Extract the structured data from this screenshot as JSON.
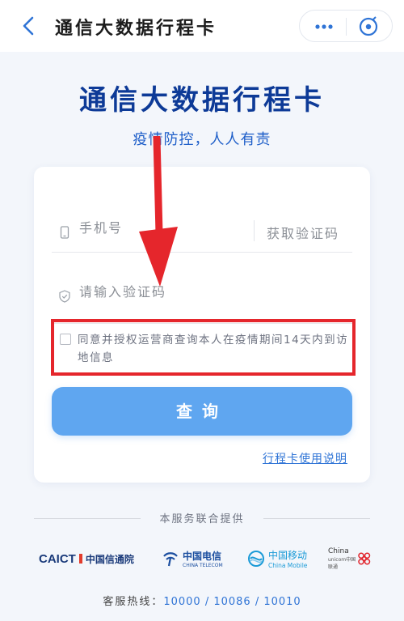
{
  "navbar": {
    "title": "通信大数据行程卡",
    "more_icon": "more-dots-icon",
    "close_icon": "close-target-icon",
    "back_icon": "chevron-left-icon"
  },
  "header": {
    "title": "通信大数据行程卡",
    "subtitle": "疫情防控，人人有责"
  },
  "form": {
    "phone_placeholder": "手机号",
    "get_code_label": "获取验证码",
    "code_placeholder": "请输入验证码",
    "consent_text": "同意并授权运营商查询本人在疫情期间14天内到访地信息",
    "consent_checked": false,
    "submit_label": "查询",
    "help_link": "行程卡使用说明"
  },
  "providers": {
    "label": "本服务联合提供",
    "caict": {
      "abbr": "CAICT",
      "name": "中国信通院"
    },
    "telecom": {
      "name": "中国电信",
      "en": "CHINA TELECOM"
    },
    "mobile": {
      "name": "中国移动",
      "en": "China Mobile"
    },
    "unicom": {
      "name": "China",
      "en": "unicom中国联通"
    }
  },
  "hotline": {
    "label": "客服热线：",
    "numbers": "10000 / 10086 / 10010"
  },
  "colors": {
    "brand_blue": "#0d3a97",
    "accent_blue": "#1f5fc9",
    "button_blue": "#5fa6f0",
    "annotation_red": "#e5262c"
  }
}
